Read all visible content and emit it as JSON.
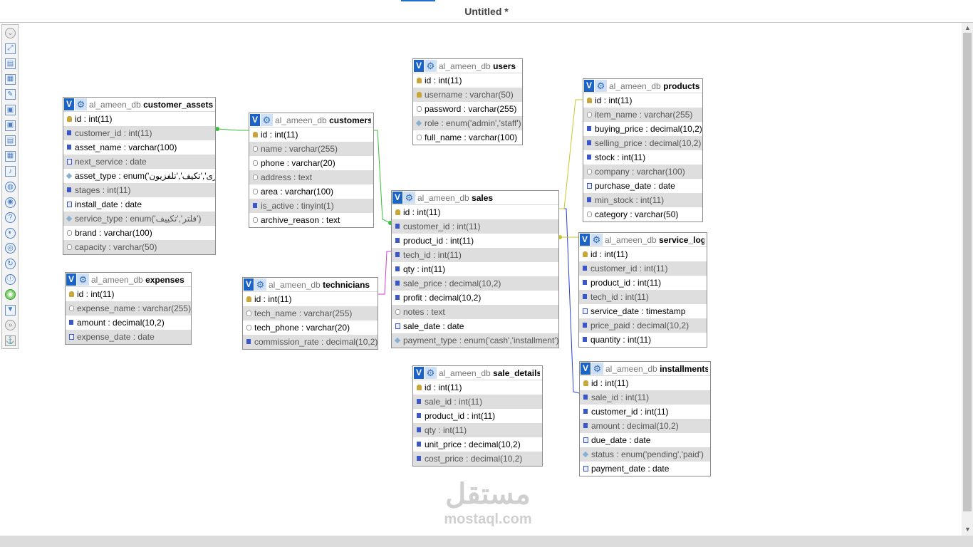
{
  "window": {
    "title": "Untitled *"
  },
  "toolbar": {
    "icons": [
      "settings-icon",
      "zoom-fit-icon",
      "export-icon",
      "import-icon",
      "edit-icon",
      "save-icon",
      "save-as-icon",
      "new-page-icon",
      "table-icon",
      "music-icon",
      "globe-icon",
      "link-icon",
      "help-icon",
      "layout-icon",
      "grid-icon",
      "refresh-icon",
      "info-icon",
      "highlight-icon",
      "download-icon",
      "clear-icon",
      "anchor-icon"
    ]
  },
  "tables": [
    {
      "db": "al_ameen_db",
      "name": "customer_assets",
      "columns": [
        "id : int(11)",
        "customer_id : int(11)",
        "asset_name : varchar(100)",
        "next_service : date",
        "asset_type : enum('أخرى','تكيف','تلفزيون')",
        "stages : int(11)",
        "install_date : date",
        "service_type : enum('فلتر','تكييف')",
        "brand : varchar(100)",
        "capacity : varchar(50)"
      ]
    },
    {
      "db": "al_ameen_db",
      "name": "customers",
      "columns": [
        "id : int(11)",
        "name : varchar(255)",
        "phone : varchar(20)",
        "address : text",
        "area : varchar(100)",
        "is_active : tinyint(1)",
        "archive_reason : text"
      ]
    },
    {
      "db": "al_ameen_db",
      "name": "users",
      "columns": [
        "id : int(11)",
        "username : varchar(50)",
        "password : varchar(255)",
        "role : enum('admin','staff')",
        "full_name : varchar(100)"
      ]
    },
    {
      "db": "al_ameen_db",
      "name": "products",
      "columns": [
        "id : int(11)",
        "item_name : varchar(255)",
        "buying_price : decimal(10,2)",
        "selling_price : decimal(10,2)",
        "stock : int(11)",
        "company : varchar(100)",
        "purchase_date : date",
        "min_stock : int(11)",
        "category : varchar(50)"
      ]
    },
    {
      "db": "al_ameen_db",
      "name": "sales",
      "columns": [
        "id : int(11)",
        "customer_id : int(11)",
        "product_id : int(11)",
        "tech_id : int(11)",
        "qty : int(11)",
        "sale_price : decimal(10,2)",
        "profit : decimal(10,2)",
        "notes : text",
        "sale_date : date",
        "payment_type : enum('cash','installment')"
      ]
    },
    {
      "db": "al_ameen_db",
      "name": "service_log",
      "columns": [
        "id : int(11)",
        "customer_id : int(11)",
        "product_id : int(11)",
        "tech_id : int(11)",
        "service_date : timestamp",
        "price_paid : decimal(10,2)",
        "quantity : int(11)"
      ]
    },
    {
      "db": "al_ameen_db",
      "name": "expenses",
      "columns": [
        "id : int(11)",
        "expense_name : varchar(255)",
        "amount : decimal(10,2)",
        "expense_date : date"
      ]
    },
    {
      "db": "al_ameen_db",
      "name": "technicians",
      "columns": [
        "id : int(11)",
        "tech_name : varchar(255)",
        "tech_phone : varchar(20)",
        "commission_rate : decimal(10,2)"
      ]
    },
    {
      "db": "al_ameen_db",
      "name": "sale_details",
      "columns": [
        "id : int(11)",
        "sale_id : int(11)",
        "product_id : int(11)",
        "qty : int(11)",
        "unit_price : decimal(10,2)",
        "cost_price : decimal(10,2)"
      ]
    },
    {
      "db": "al_ameen_db",
      "name": "installments",
      "columns": [
        "id : int(11)",
        "sale_id : int(11)",
        "customer_id : int(11)",
        "amount : decimal(10,2)",
        "due_date : date",
        "status : enum('pending','paid')",
        "payment_date : date"
      ]
    }
  ],
  "relations": [
    {
      "from": "customer_assets.customer_id",
      "to": "customers.id",
      "color": "#36c03a"
    },
    {
      "from": "sales.customer_id",
      "to": "customers.id",
      "color": "#36c03a"
    },
    {
      "from": "sales.tech_id",
      "to": "technicians.id",
      "color": "#d23ad6"
    },
    {
      "from": "sales.id",
      "to": "installments.sale_id",
      "color": "#2a3fd0"
    },
    {
      "from": "sales.product_id",
      "to": "products.id",
      "color": "#c9c62a"
    },
    {
      "from": "service_log",
      "to": "sales",
      "color": "#c9c62a"
    }
  ],
  "watermark": {
    "arabic": "مستقل",
    "latin": "mostaql.com"
  }
}
